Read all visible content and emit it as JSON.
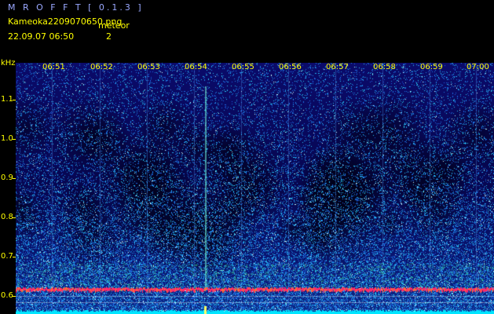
{
  "app": {
    "title": "M R O F F T  [ 0.1.3 ]"
  },
  "file": {
    "name": "Kameoka2209070650.png",
    "datetime": "22.09.07 06:50"
  },
  "meteor": {
    "label": "meteor",
    "count": "2"
  },
  "axis": {
    "unit": "kHz",
    "freq_labels": [
      "1.1",
      "1.0",
      "0.9",
      "0.8",
      "0.7",
      "0.6"
    ],
    "time_labels": [
      "06:51",
      "06:52",
      "06:53",
      "06:54",
      "06:55",
      "06:56",
      "06:57",
      "06:58",
      "06:59",
      "07:00"
    ]
  },
  "colors": {
    "text": "#ffff00",
    "title": "#9aa8ff",
    "background": "#000000",
    "spectrogram_low": "#0a0a66",
    "signal_band": "#ff2a6a",
    "baseline": "#00e5ff"
  }
}
